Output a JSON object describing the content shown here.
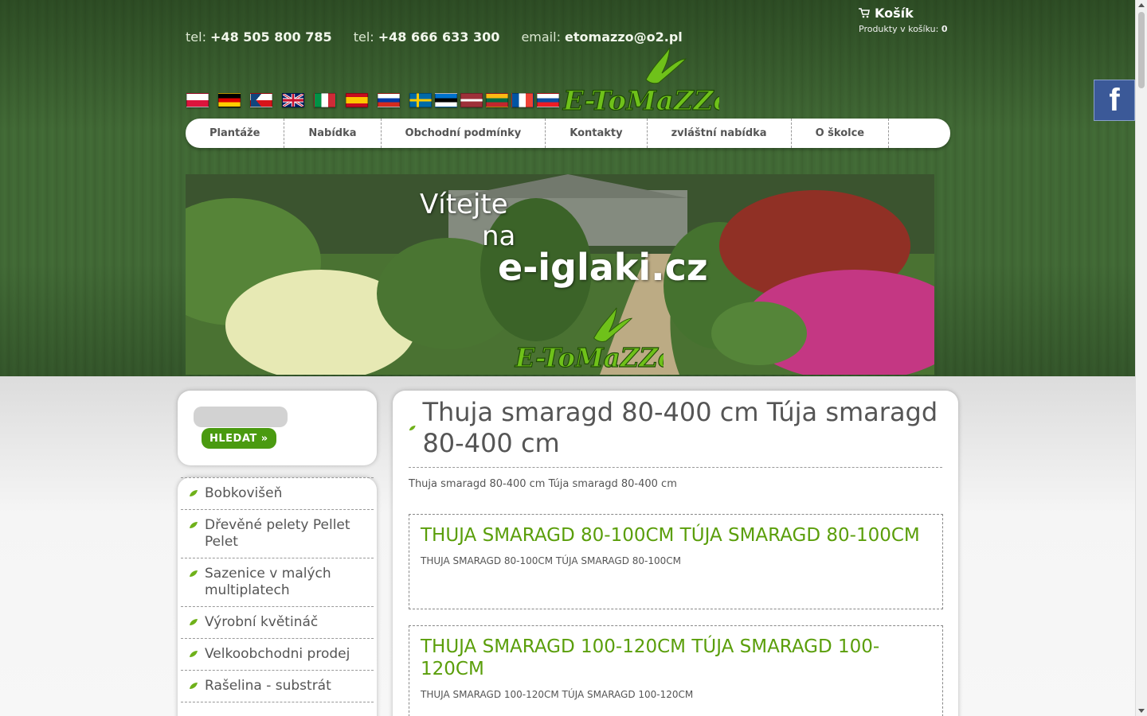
{
  "contacts": {
    "tel1_label": "tel:",
    "tel1": "+48 505 800 785",
    "tel2_label": "tel:",
    "tel2": "+48 666 633 300",
    "email_label": "email:",
    "email": "etomazzo@o2.pl"
  },
  "cart": {
    "title": "Košík",
    "products_label": "Produkty v košíku:",
    "count": "0"
  },
  "flags": [
    "pl",
    "de",
    "cz",
    "gb",
    "it",
    "es",
    "ru",
    "se",
    "ee",
    "lv",
    "lt",
    "fr",
    "sk"
  ],
  "nav": {
    "items": [
      "Plantáže",
      "Nabídka",
      "Obchodní podmínky",
      "Kontakty",
      "zvláštní nabídka",
      "O školce"
    ]
  },
  "banner": {
    "line1": "Vítejte",
    "line2": "na",
    "line3": "e-iglaki.cz"
  },
  "search": {
    "button_label": "HLEDAT »"
  },
  "categories": [
    "Bobkovišeň",
    "Dřevěné pelety Pellet Pelet",
    "Sazenice v malých multiplatech",
    "Výrobní květináč",
    "Velkoobchodni prodej",
    "Rašelina - substrát"
  ],
  "main": {
    "title": "Thuja smaragd 80-400 cm Túja smaragd 80-400 cm",
    "description": "Thuja smaragd 80-400 cm Túja smaragd 80-400 cm",
    "products": [
      {
        "title": "THUJA SMARAGD 80-100CM TÚJA SMARAGD 80-100CM",
        "desc": "THUJA SMARAGD 80-100CM TÚJA SMARAGD 80-100CM"
      },
      {
        "title": "THUJA SMARAGD 100-120CM TÚJA SMARAGD 100-120CM",
        "desc": "THUJA SMARAGD 100-120CM TÚJA SMARAGD 100-120CM"
      }
    ]
  },
  "logo_text": "E-ToMaZZo",
  "colors": {
    "header_green": "#3f6634",
    "accent_green": "#5a9e0a",
    "button_green": "#4a9a10",
    "facebook": "#3b5998"
  }
}
